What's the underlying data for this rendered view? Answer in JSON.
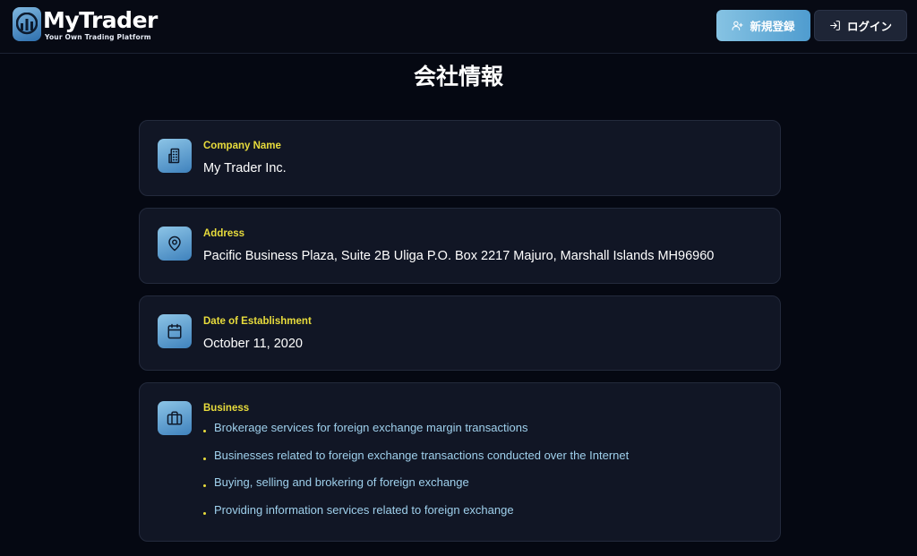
{
  "header": {
    "brand_name": "MyTrader",
    "brand_tagline": "Your Own Trading Platform",
    "register_label": "新規登録",
    "login_label": "ログイン"
  },
  "page": {
    "title": "会社情報"
  },
  "company": {
    "name_label": "Company Name",
    "name_value": "My Trader Inc.",
    "address_label": "Address",
    "address_value": "Pacific Business Plaza, Suite 2B Uliga P.O. Box 2217 Majuro, Marshall Islands MH96960",
    "date_label": "Date of Establishment",
    "date_value": "October 11, 2020",
    "business_label": "Business",
    "business_items": [
      "Brokerage services for foreign exchange margin transactions",
      "Businesses related to foreign exchange transactions conducted over the Internet",
      "Buying, selling and brokering of foreign exchange",
      "Providing information services related to foreign exchange"
    ]
  },
  "colors": {
    "background": "#050812",
    "card": "#111625",
    "label_accent": "#e8dc3c",
    "list_text": "#9fd0ec",
    "brand_blue": "#4f9ccf"
  },
  "icons": [
    "logo-chart-icon",
    "user-plus-icon",
    "login-icon",
    "building-icon",
    "map-pin-icon",
    "calendar-icon",
    "briefcase-icon"
  ]
}
